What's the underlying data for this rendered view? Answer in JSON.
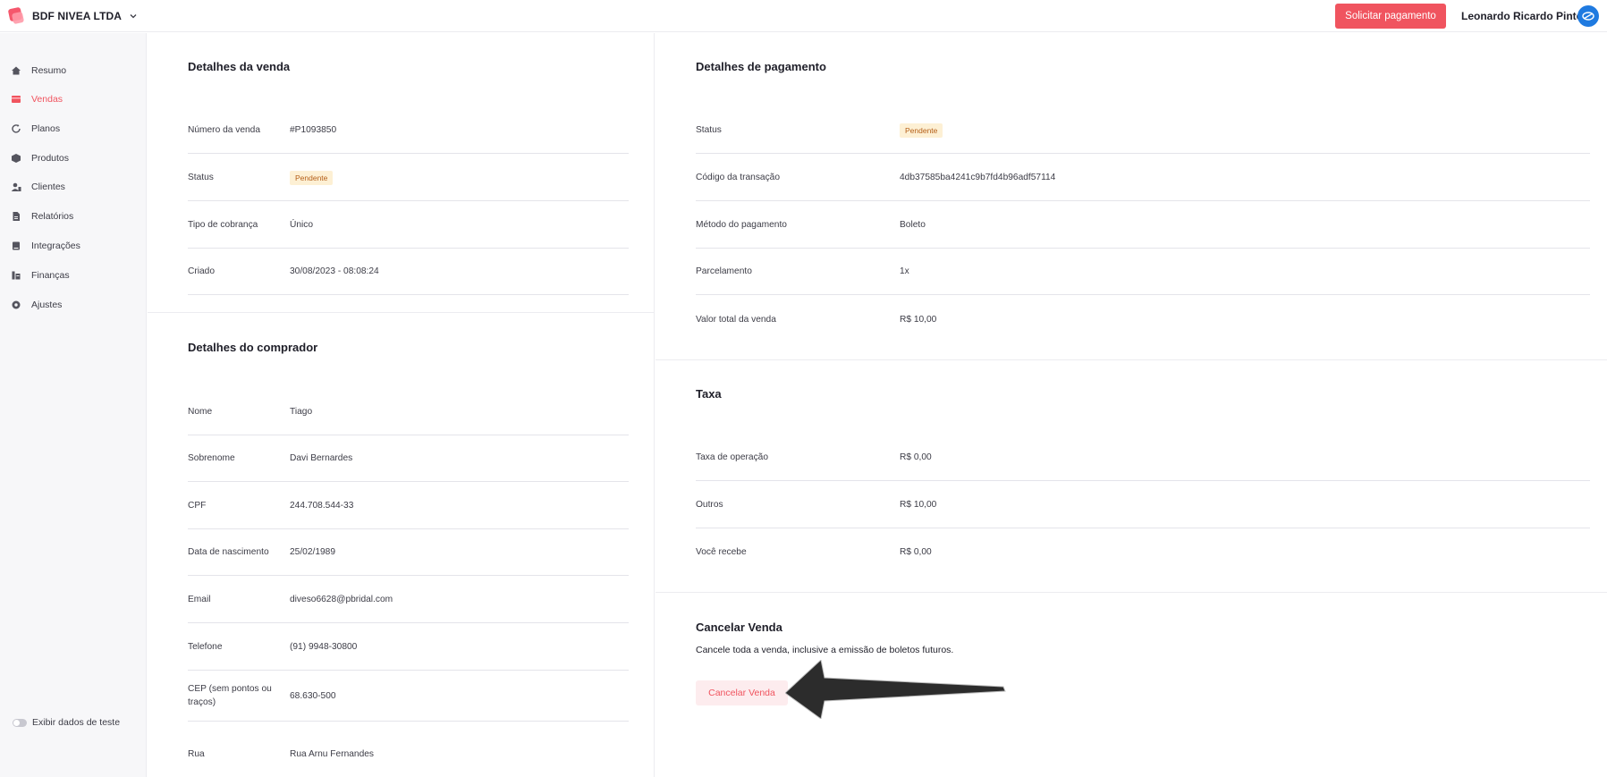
{
  "header": {
    "company": "BDF NIVEA LTDA",
    "request_payment": "Solicitar pagamento",
    "user_name": "Leonardo Ricardo Pinto"
  },
  "sidebar": {
    "items": [
      {
        "label": "Resumo",
        "icon": "home-icon"
      },
      {
        "label": "Vendas",
        "icon": "sales-icon",
        "active": true
      },
      {
        "label": "Planos",
        "icon": "refresh-icon"
      },
      {
        "label": "Produtos",
        "icon": "box-icon"
      },
      {
        "label": "Clientes",
        "icon": "users-icon"
      },
      {
        "label": "Relatórios",
        "icon": "report-icon"
      },
      {
        "label": "Integrações",
        "icon": "integration-icon"
      },
      {
        "label": "Finanças",
        "icon": "finance-icon"
      },
      {
        "label": "Ajustes",
        "icon": "gear-icon"
      }
    ],
    "test_toggle": "Exibir dados de teste"
  },
  "sale_details": {
    "title": "Detalhes da venda",
    "rows": [
      {
        "label": "Número da venda",
        "value": "#P1093850"
      },
      {
        "label": "Status",
        "value": "Pendente"
      },
      {
        "label": "Tipo de cobrança",
        "value": "Único"
      },
      {
        "label": "Criado",
        "value": "30/08/2023 - 08:08:24"
      }
    ]
  },
  "buyer_details": {
    "title": "Detalhes do comprador",
    "rows": [
      {
        "label": "Nome",
        "value": "Tiago"
      },
      {
        "label": "Sobrenome",
        "value": "Davi Bernardes"
      },
      {
        "label": "CPF",
        "value": "244.708.544-33"
      },
      {
        "label": "Data de nascimento",
        "value": "25/02/1989"
      },
      {
        "label": "Email",
        "value": "diveso6628@pbridal.com"
      },
      {
        "label": "Telefone",
        "value": "(91) 9948-30800"
      },
      {
        "label": "CEP (sem pontos ou traços)",
        "value": "68.630-500"
      },
      {
        "label": "Rua",
        "value": "Rua Arnu Fernandes"
      }
    ]
  },
  "payment_details": {
    "title": "Detalhes de pagamento",
    "rows": [
      {
        "label": "Status",
        "value": "Pendente"
      },
      {
        "label": "Código da transação",
        "value": "4db37585ba4241c9b7fd4b96adf57114"
      },
      {
        "label": "Método do pagamento",
        "value": "Boleto"
      },
      {
        "label": "Parcelamento",
        "value": "1x"
      },
      {
        "label": "Valor total da venda",
        "value": "R$ 10,00"
      }
    ]
  },
  "fee": {
    "title": "Taxa",
    "rows": [
      {
        "label": "Taxa de operação",
        "value": "R$ 0,00"
      },
      {
        "label": "Outros",
        "value": "R$ 10,00"
      },
      {
        "label": "Você recebe",
        "value": "R$ 0,00"
      }
    ]
  },
  "cancel": {
    "title": "Cancelar Venda",
    "description": "Cancele toda a venda, inclusive a emissão de boletos futuros.",
    "button": "Cancelar Venda"
  },
  "colors": {
    "accent": "#f0545f",
    "badge_bg": "#fdf0d4",
    "badge_text": "#b55f18"
  }
}
